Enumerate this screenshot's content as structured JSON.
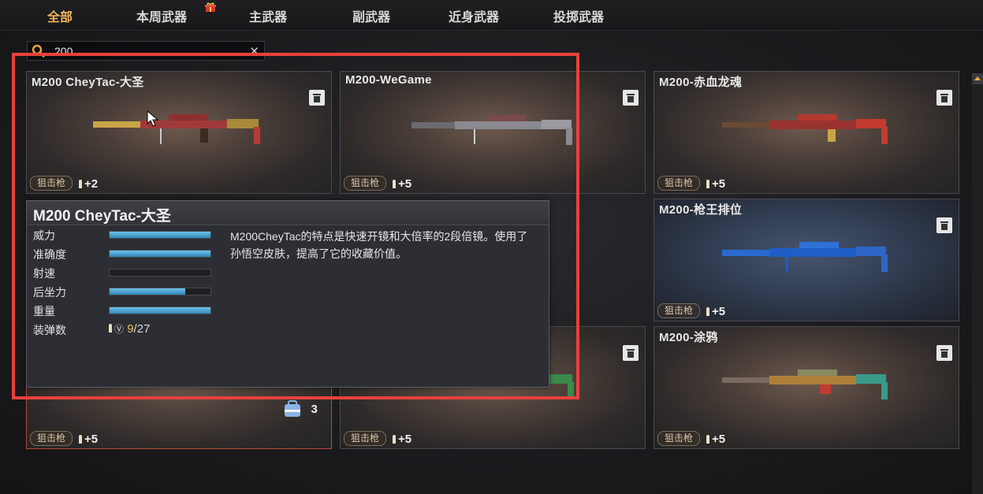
{
  "tabs": [
    {
      "label": "全部",
      "active": true
    },
    {
      "label": "本周武器"
    },
    {
      "label": "主武器"
    },
    {
      "label": "副武器"
    },
    {
      "label": "近身武器"
    },
    {
      "label": "投掷武器"
    }
  ],
  "search": {
    "value": "200"
  },
  "cards": [
    {
      "name": "M200 CheyTac-大圣",
      "category": "狙击枪",
      "ammo": "+2"
    },
    {
      "name": "M200-WeGame",
      "category": "狙击枪",
      "ammo": "+5"
    },
    {
      "name": "M200-赤血龙魂",
      "category": "狙击枪",
      "ammo": "+5"
    },
    {
      "name": "M200-枪王排位",
      "category": "狙击枪",
      "ammo": "+5"
    },
    {
      "name": "",
      "category": "狙击枪",
      "ammo": "+5"
    },
    {
      "name": "",
      "category": "狙击枪",
      "ammo": "+5"
    },
    {
      "name": "M200-涂鸦",
      "category": "狙击枪",
      "ammo": "+5"
    }
  ],
  "tooltip": {
    "title": "M200 CheyTac-大圣",
    "stats": [
      {
        "label": "威力",
        "level": 1.0
      },
      {
        "label": "准确度",
        "level": 1.0
      },
      {
        "label": "射速",
        "level": 0.0
      },
      {
        "label": "后坐力",
        "level": 0.75
      },
      {
        "label": "重量",
        "level": 1.0
      }
    ],
    "ammo_label": "装弹数",
    "ammo_loaded": "9",
    "ammo_total": "/27",
    "description": "M200CheyTac的特点是快速开镜和大倍率的2段倍镜。使用了孙悟空皮肤，提高了它的收藏价值。"
  },
  "inventory_count": "3",
  "colors": {
    "accent_tab": "#f0b55a",
    "highlight_box": "#e8413c",
    "stat_fill": "#2f85b8"
  }
}
